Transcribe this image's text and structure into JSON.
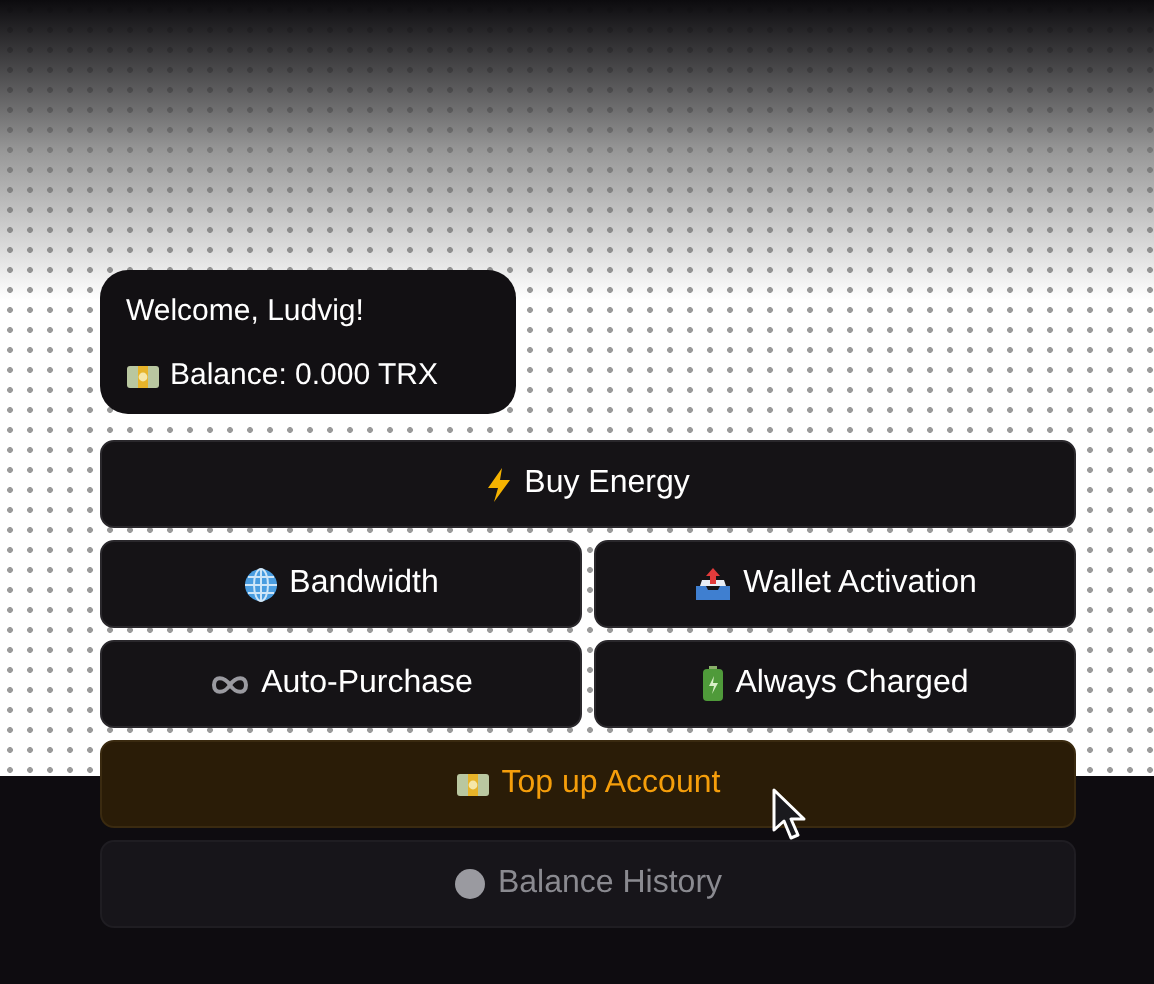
{
  "welcome": {
    "greeting": "Welcome, Ludvig!",
    "balance": "Balance: 0.000 TRX"
  },
  "buttons": [
    {
      "label": "Buy Energy",
      "wide": true,
      "kind": "normal"
    },
    {
      "label": "Bandwidth",
      "wide": false,
      "kind": "normal"
    },
    {
      "label": "Wallet Activation",
      "wide": false,
      "kind": "normal"
    },
    {
      "label": "Auto-Purchase",
      "wide": false,
      "kind": "normal"
    },
    {
      "label": "Always Charged",
      "wide": false,
      "kind": "normal"
    },
    {
      "label": "Top up Account",
      "wide": true,
      "kind": "hovered"
    },
    {
      "label": "Balance History",
      "wide": true,
      "kind": "faded"
    }
  ]
}
